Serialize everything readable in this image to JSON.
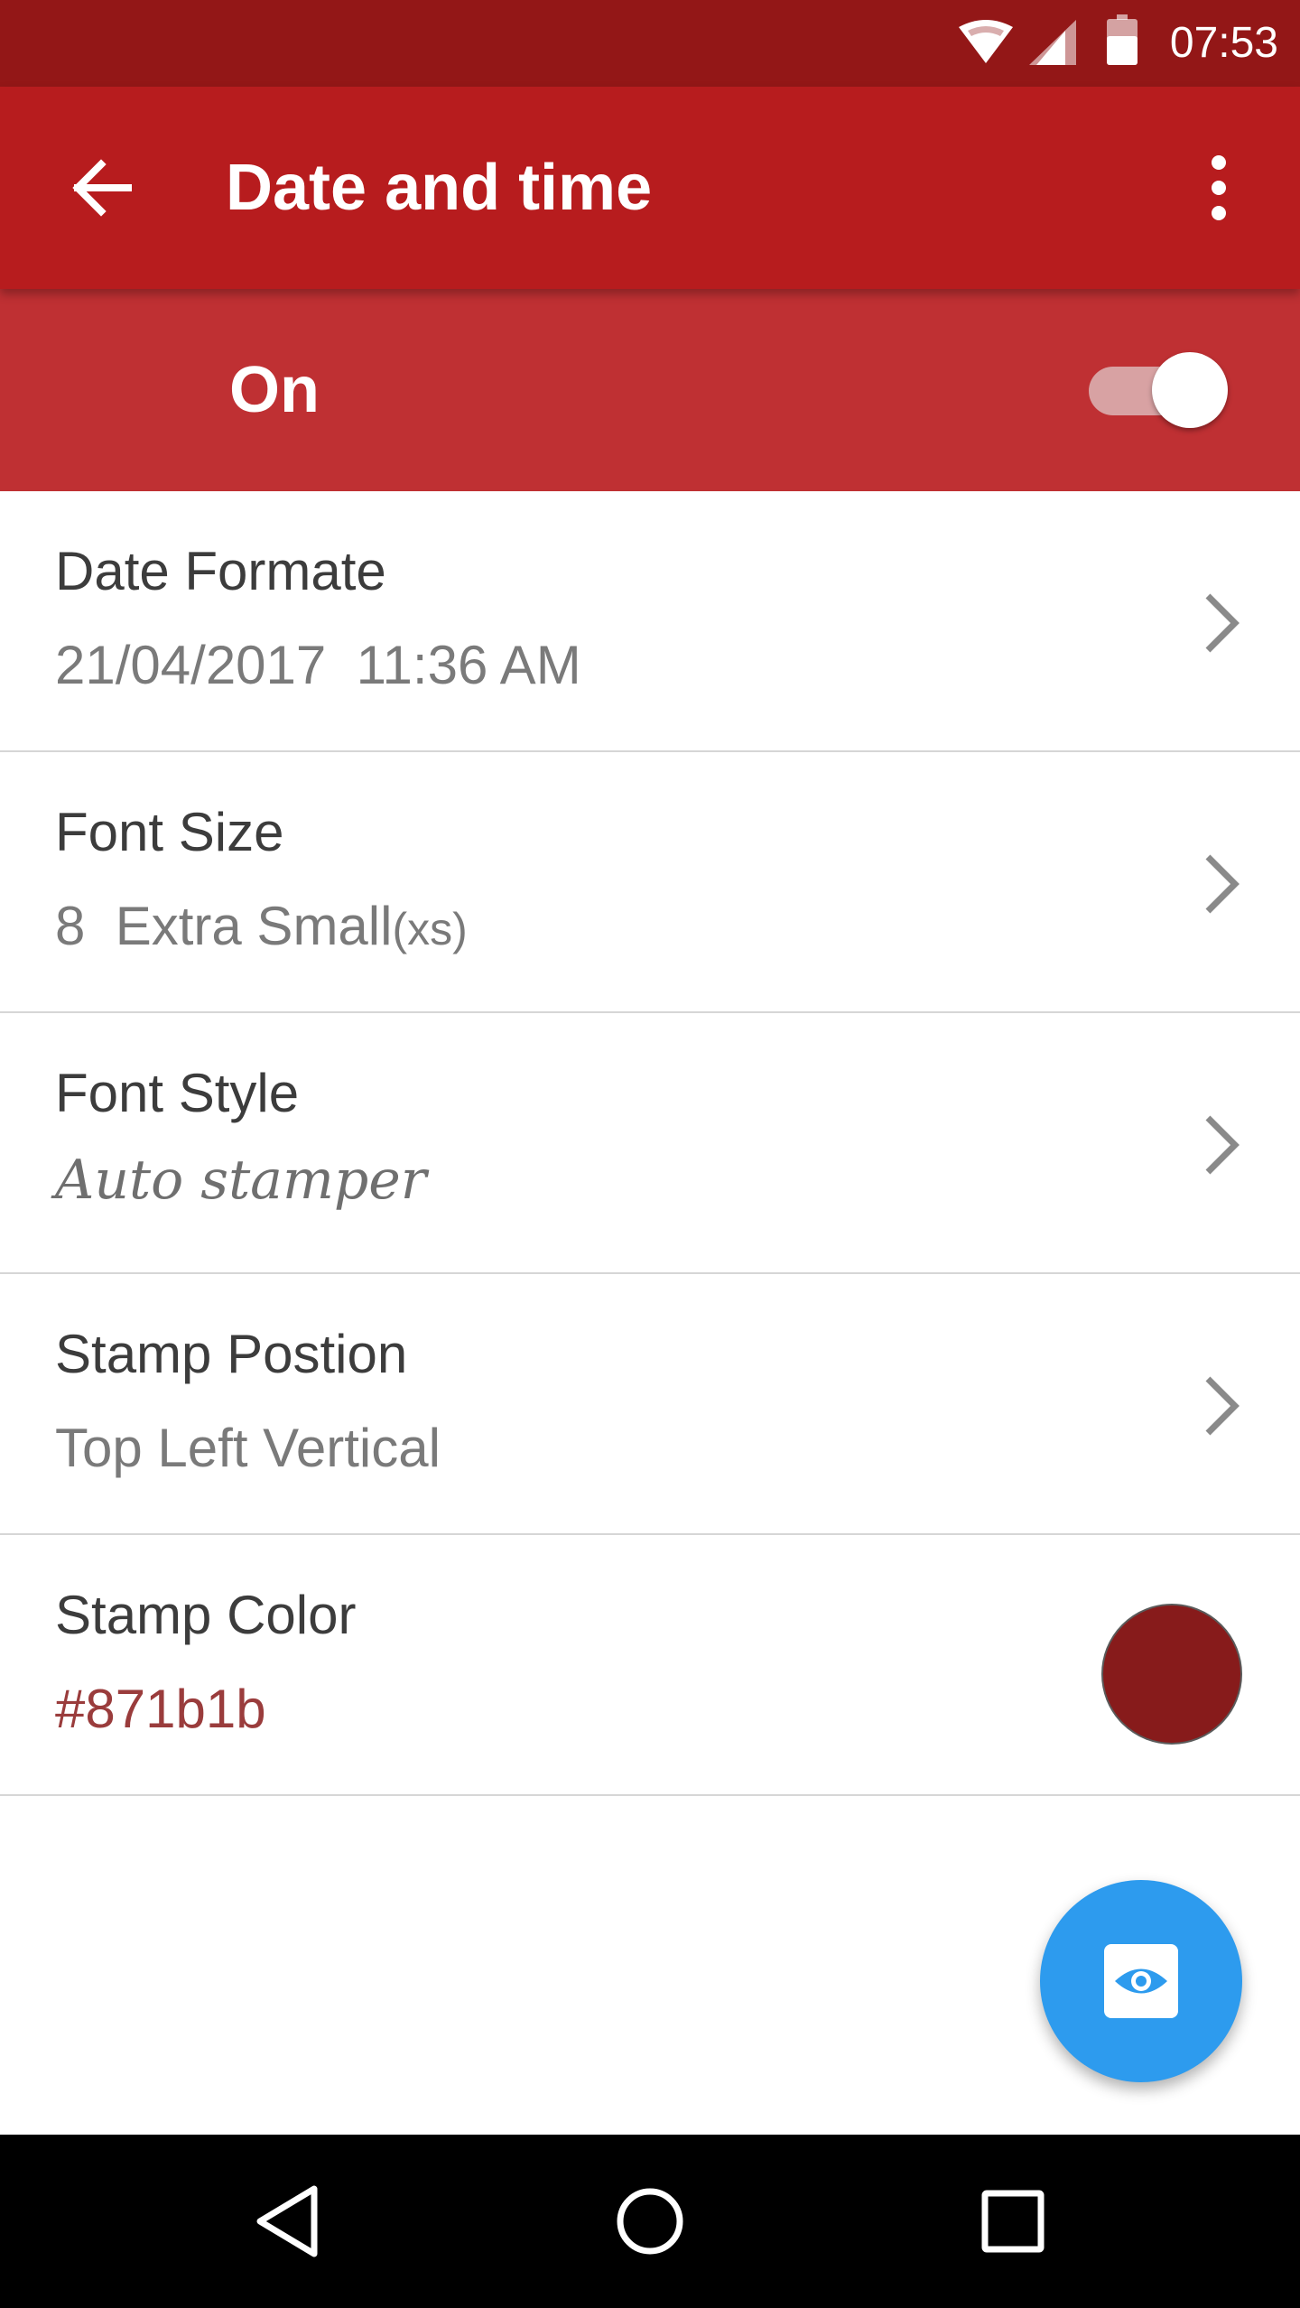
{
  "status_bar": {
    "time": "07:53",
    "icons": [
      "wifi-icon",
      "cellular-signal-icon",
      "battery-icon"
    ]
  },
  "app_bar": {
    "title": "Date and time",
    "back_icon": "arrow-back-icon",
    "overflow_icon": "more-vert-icon"
  },
  "master_switch": {
    "label": "On",
    "enabled": true
  },
  "settings": [
    {
      "title": "Date Formate",
      "value": "21/04/2017  11:36 AM"
    },
    {
      "title": "Font Size",
      "value": "8  Extra Small",
      "value_suffix": "(xs)"
    },
    {
      "title": "Font Style",
      "value": "Auto stamper"
    },
    {
      "title": "Stamp Postion",
      "value": "Top Left Vertical"
    },
    {
      "title": "Stamp Color",
      "value": "#871b1b"
    }
  ],
  "colors": {
    "status_bar": "#931717",
    "app_bar": "#b71c1e",
    "switch_bar": "#bf3033",
    "stamp_color": "#871b1b",
    "fab": "#2d9bee"
  },
  "fab": {
    "icon": "eye-preview-icon"
  },
  "nav_bar": {
    "icons": [
      "nav-back-icon",
      "nav-home-icon",
      "nav-recents-icon"
    ]
  }
}
